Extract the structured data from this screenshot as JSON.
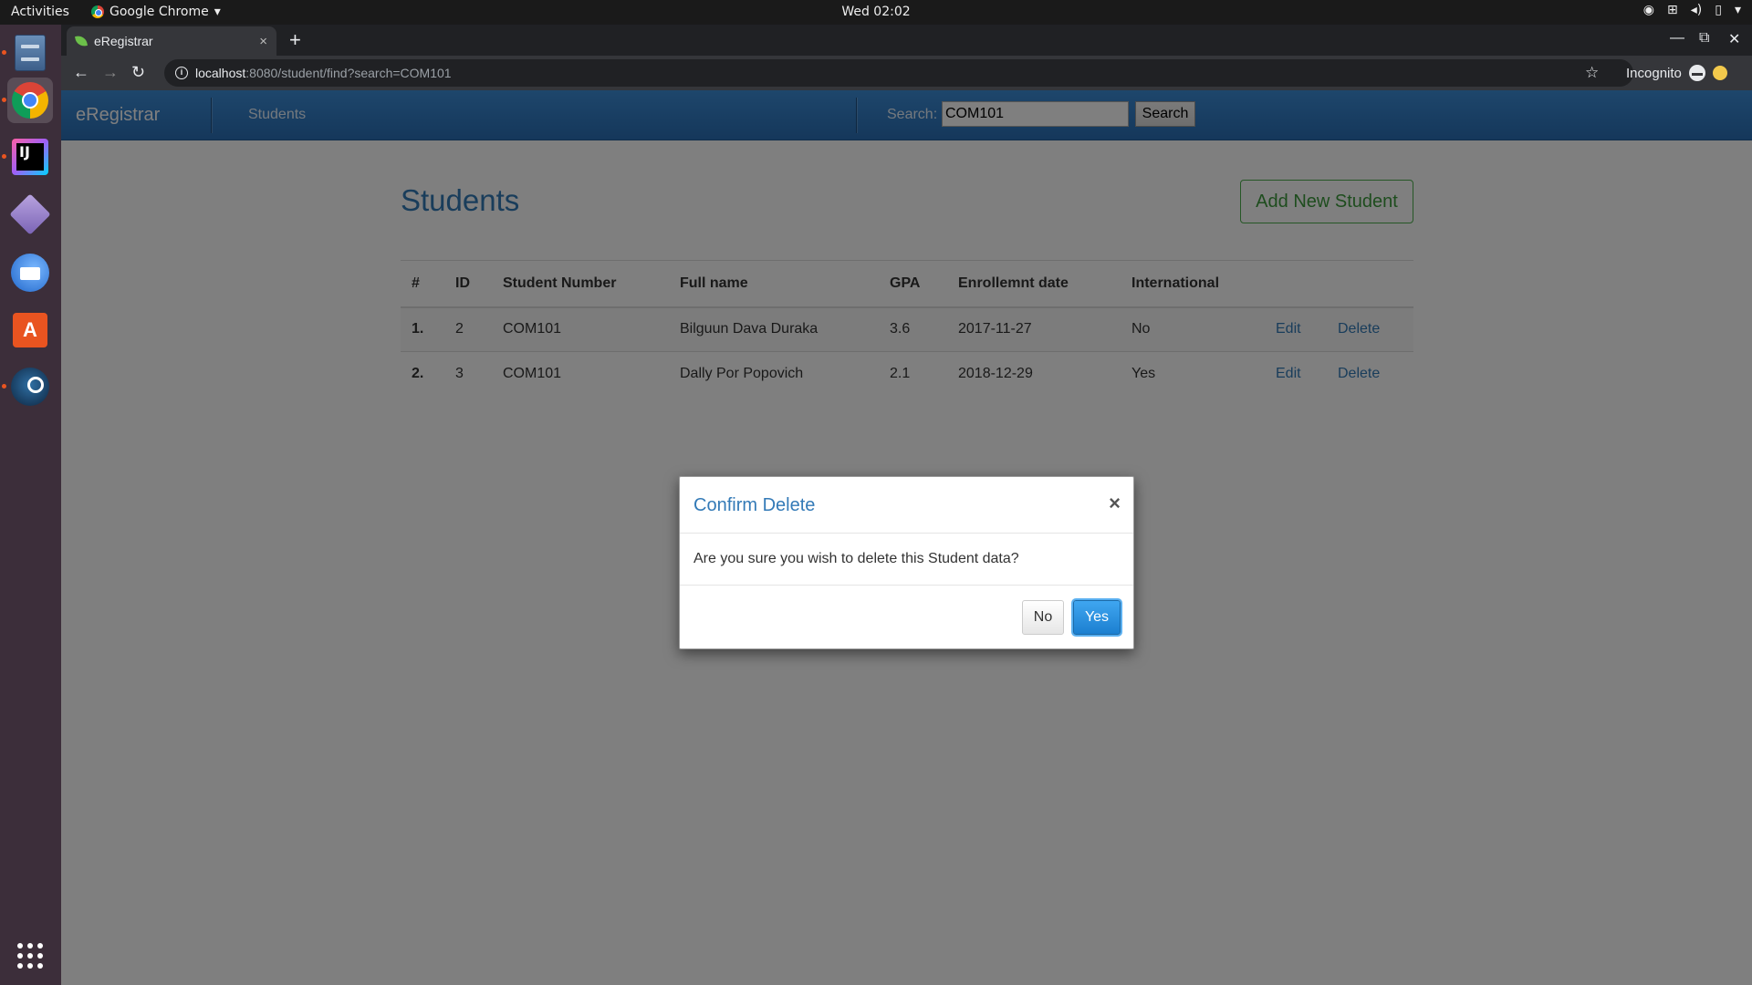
{
  "system_bar": {
    "activities": "Activities",
    "app_name": "Google Chrome",
    "clock": "Wed 02:02",
    "menu_arrow": "▾"
  },
  "dock": {
    "items": [
      "files-icon",
      "chrome-icon",
      "intellij-icon",
      "diagram-icon",
      "thunderbird-icon",
      "software-store-icon",
      "steam-icon",
      "show-apps-icon"
    ]
  },
  "browser": {
    "tab_title": "eRegistrar",
    "tab_close": "×",
    "new_tab": "+",
    "url_host": "localhost",
    "url_rest": ":8080/student/find?search=COM101",
    "incognito_label": "Incognito"
  },
  "navbar": {
    "brand": "eRegistrar",
    "students_link": "Students",
    "search_label": "Search:",
    "search_value": "COM101",
    "search_button": "Search"
  },
  "page": {
    "title": "Students",
    "add_button": "Add New Student"
  },
  "table": {
    "headers": [
      "#",
      "ID",
      "Student Number",
      "Full name",
      "GPA",
      "Enrollemnt date",
      "International"
    ],
    "rows": [
      {
        "num": "1.",
        "id": "2",
        "student_number": "COM101",
        "full_name": "Bilguun Dava Duraka",
        "gpa": "3.6",
        "enrollment_date": "2017-11-27",
        "international": "No",
        "edit": "Edit",
        "delete": "Delete"
      },
      {
        "num": "2.",
        "id": "3",
        "student_number": "COM101",
        "full_name": "Dally Por Popovich",
        "gpa": "2.1",
        "enrollment_date": "2018-12-29",
        "international": "Yes",
        "edit": "Edit",
        "delete": "Delete"
      }
    ]
  },
  "modal": {
    "title": "Confirm Delete",
    "close": "×",
    "body": "Are you sure you wish to delete this Student data?",
    "no_button": "No",
    "yes_button": "Yes"
  },
  "colors": {
    "navbar": "#2a6fb6",
    "link": "#337ab7",
    "success": "#4cae4c",
    "primary_button": "#1c7fd0"
  }
}
